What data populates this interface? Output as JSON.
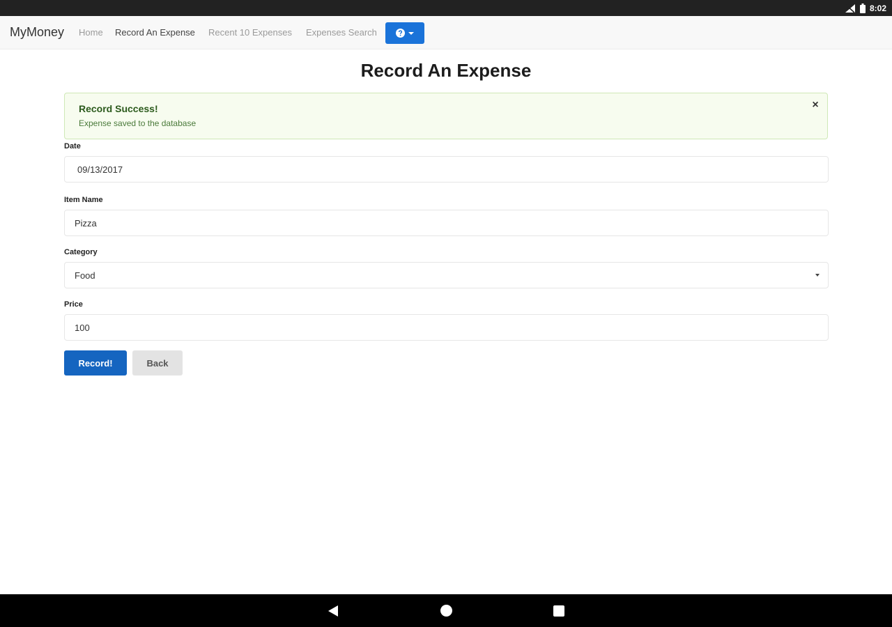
{
  "statusbar": {
    "time": "8:02"
  },
  "navbar": {
    "brand": "MyMoney",
    "links": {
      "home": "Home",
      "record": "Record An Expense",
      "recent": "Recent 10 Expenses",
      "search": "Expenses Search"
    },
    "help_icon": "question-circle-icon",
    "accent_color": "#1a73d9"
  },
  "page": {
    "title": "Record An Expense"
  },
  "alert": {
    "title": "Record Success!",
    "message": "Expense saved to the database",
    "close_glyph": "×"
  },
  "form": {
    "date": {
      "label": "Date",
      "value": "09/13/2017"
    },
    "item_name": {
      "label": "Item Name",
      "value": "Pizza"
    },
    "category": {
      "label": "Category",
      "value": "Food"
    },
    "price": {
      "label": "Price",
      "value": "100"
    }
  },
  "buttons": {
    "record": "Record!",
    "back": "Back"
  }
}
